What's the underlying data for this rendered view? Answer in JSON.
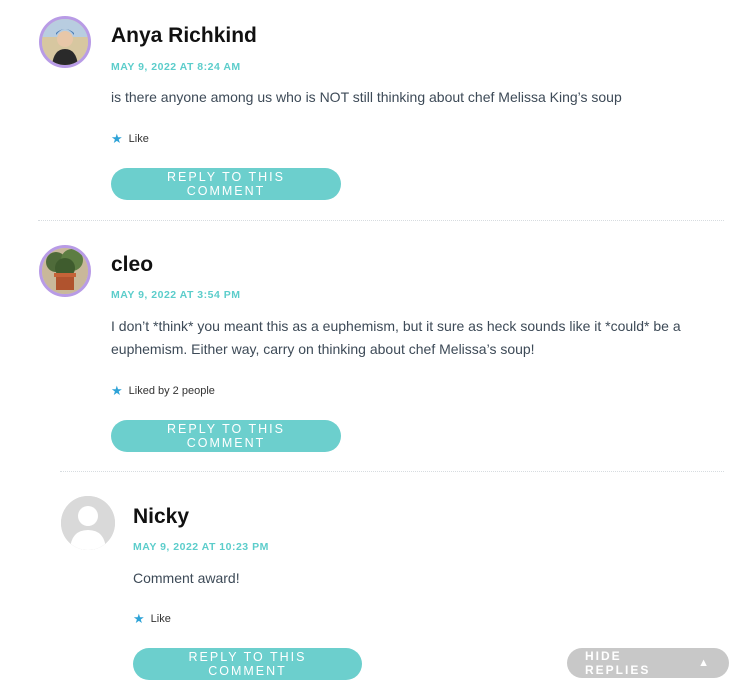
{
  "comments": [
    {
      "author": "Anya Richkind",
      "date": "MAY 9, 2022 AT 8:24 AM",
      "text": "is there anyone among us who is NOT still thinking about chef Melissa King’s soup",
      "like": "Like",
      "reply": "REPLY TO THIS COMMENT"
    },
    {
      "author": "cleo",
      "date": "MAY 9, 2022 AT 3:54 PM",
      "text": "I don’t *think* you meant this as a euphemism, but it sure as heck sounds like it *could* be a euphemism. Either way, carry on thinking about chef Melissa’s soup!",
      "like": "Liked by 2 people",
      "reply": "REPLY TO THIS COMMENT"
    },
    {
      "author": "Nicky",
      "date": "MAY 9, 2022 AT 10:23 PM",
      "text": "Comment award!",
      "like": "Like",
      "reply": "REPLY TO THIS COMMENT"
    }
  ],
  "hide_replies": {
    "label": "HIDE REPLIES",
    "icon": "triangle-up-icon"
  },
  "colors": {
    "accent": "#5ccdcb",
    "button": "#6ccfcd",
    "avatar_ring": "#b89be6",
    "star": "#2ea3d7"
  }
}
